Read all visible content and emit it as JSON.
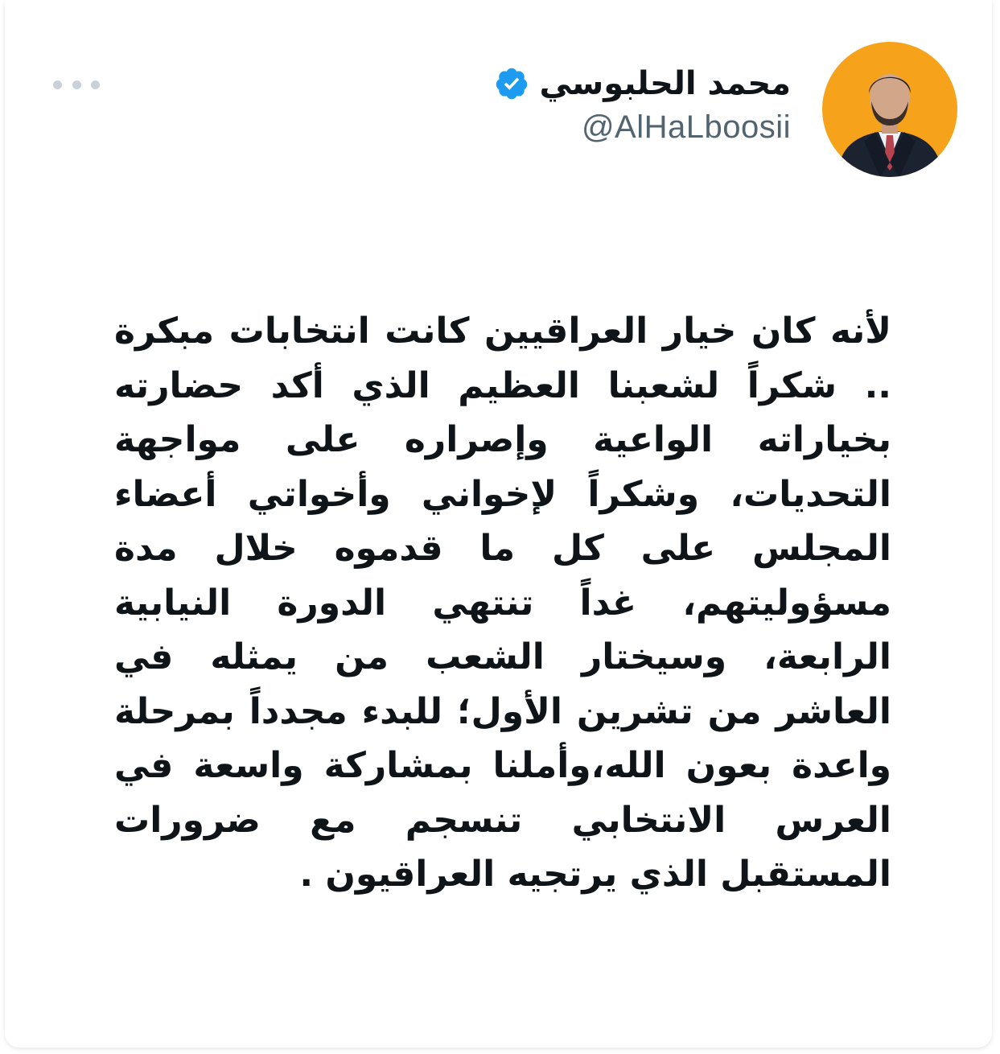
{
  "author": {
    "display_name": "محمد الحلبوسي",
    "handle": "@AlHaLboosii",
    "verified": true,
    "avatar_icon": "profile-photo"
  },
  "menu": {
    "icon": "more-horizontal-icon"
  },
  "tweet": {
    "text": "لأنه كان خيار العراقيين كانت انتخابات مبكرة .. شكراً لشعبنا العظيم الذي أكد حضارته بخياراته الواعية وإصراره على مواجهة التحديات، وشكراً لإخواني وأخواتي أعضاء المجلس على كل ما قدموه خلال مدة مسؤوليتهم، غداً تنتهي الدورة النيابية الرابعة، وسيختار الشعب من يمثله في العاشر من تشرين الأول؛ للبدء مجدداً بمرحلة واعدة بعون الله،وأملنا بمشاركة واسعة في العرس الانتخابي تنسجم مع ضرورات المستقبل الذي يرتجيه العراقيون ."
  },
  "colors": {
    "avatar_background": "#f7a21b",
    "verified_badge": "#1d9bf0",
    "handle_text": "#536471",
    "body_text": "#0f1419",
    "more_dots": "#c9d0d7"
  }
}
